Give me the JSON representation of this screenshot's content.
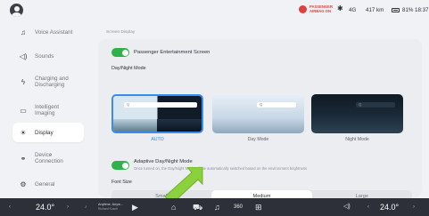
{
  "status_bar": {
    "airbag_line1": "PASSENGER",
    "airbag_line2": "AIRBAG ON",
    "bluetooth_icon": "bluetooth-icon",
    "signal_text": "4G",
    "range": "417 km",
    "battery": "81%",
    "time": "18:37"
  },
  "sidebar": {
    "items": [
      {
        "label": "Voice Assistant",
        "icon": "bell-icon",
        "glyph": "♫"
      },
      {
        "label": "Sounds",
        "icon": "speaker-icon",
        "glyph": "◁)"
      },
      {
        "label": "Charging and Discharging",
        "icon": "lightning-icon",
        "glyph": "⚡"
      },
      {
        "label": "Intelligent Imaging",
        "icon": "camera-icon",
        "glyph": "▭"
      },
      {
        "label": "Display",
        "icon": "sun-icon",
        "glyph": "☀"
      },
      {
        "label": "Device Connection",
        "icon": "link-icon",
        "glyph": "⚭"
      },
      {
        "label": "General",
        "icon": "gear-icon",
        "glyph": "⚙"
      }
    ]
  },
  "main": {
    "section_title": "Screen Display",
    "passenger_toggle_label": "Passenger Entertainment Screen",
    "day_night_label": "Day/Night Mode",
    "theme_options": [
      {
        "label": "AUTO",
        "selected": true
      },
      {
        "label": "Day Mode",
        "selected": false
      },
      {
        "label": "Night Mode",
        "selected": false
      }
    ],
    "adaptive_label": "Adaptive Day/Night Mode",
    "adaptive_help": "Once turned on, the Day/Night Mode will be automatically switched based on the environment brightness",
    "font_size_label": "Font Size",
    "font_sizes": [
      {
        "label": "Small",
        "selected": false
      },
      {
        "label": "Medium",
        "selected": true
      },
      {
        "label": "Large",
        "selected": false
      }
    ]
  },
  "bottom_bar": {
    "left_temp": "24.0°",
    "right_temp": "24.0°",
    "song_title": "Anytime, Anyw...",
    "song_artist": "Richard Kusch",
    "fan_label": "360"
  },
  "colors": {
    "accent_green": "#2fb14b",
    "selection_blue": "#3a8df0",
    "annotation_arrow": "#8bd13b"
  }
}
